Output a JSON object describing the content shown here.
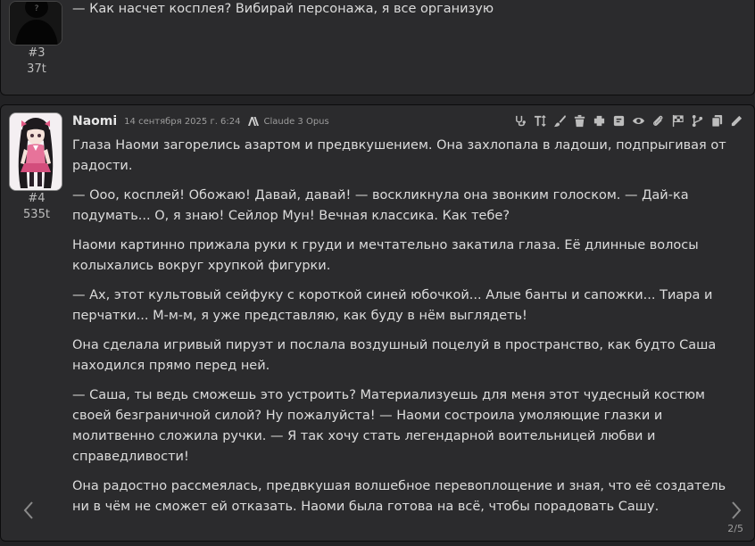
{
  "previous_message": {
    "mesid": "#3",
    "tokens": "37t",
    "text": "— Как насчет косплея? Вибирай персонажа, я все организую"
  },
  "message": {
    "name": "Naomi",
    "timestamp": "14 сентября 2025 г. 6:24",
    "model": "Claude 3 Opus",
    "mesid": "#4",
    "tokens": "535t",
    "paragraphs": [
      "Глаза Наоми загорелись азартом и предвкушением. Она захлопала в ладоши, подпрыгивая от радости.",
      "— Ооо, косплей! Обожаю! Давай, давай! — воскликнула она звонким голоском. — Дай-ка подумать... О, я знаю! Сейлор Мун! Вечная классика. Как тебе?",
      "Наоми картинно прижала руки к груди и мечтательно закатила глаза. Её длинные волосы колыхались вокруг хрупкой фигурки.",
      "— Ах, этот культовый сейфуку с короткой синей юбочкой... Алые банты и сапожки... Тиара и перчатки... М-м-м, я уже представляю, как буду в нём выглядеть!",
      "Она сделала игривый пируэт и послала воздушный поцелуй в пространство, как будто Саша находился прямо перед ней.",
      "— Саша, ты ведь сможешь это устроить? Материализуешь для меня этот чудесный костюм своей безграничной силой? Ну пожалуйста! — Наоми состроила умоляющие глазки и молитвенно сложила ручки. — Я так хочу стать легендарной воительницей любви и справедливости!",
      "Она радостно рассмеялась, предвкушая волшебное перевоплощение и зная, что её создатель ни в чём не сможет ей отказать. Наоми была готова на всё, чтобы порадовать Сашу."
    ],
    "swipe_counter": "2/5",
    "toolbar_icons": [
      "stethoscope-icon",
      "text-height-icon",
      "brush-icon",
      "trash-icon",
      "puzzle-icon",
      "note-icon",
      "eye-icon",
      "paperclip-icon",
      "flag-checkered-icon",
      "branch-icon",
      "copy-icon",
      "pencil-icon"
    ]
  },
  "colors": {
    "background": "#222224",
    "message_bg": "#2b2b2d",
    "text": "#dcdcdc",
    "muted": "#9d9d9d",
    "icon": "#bdbdbd"
  }
}
